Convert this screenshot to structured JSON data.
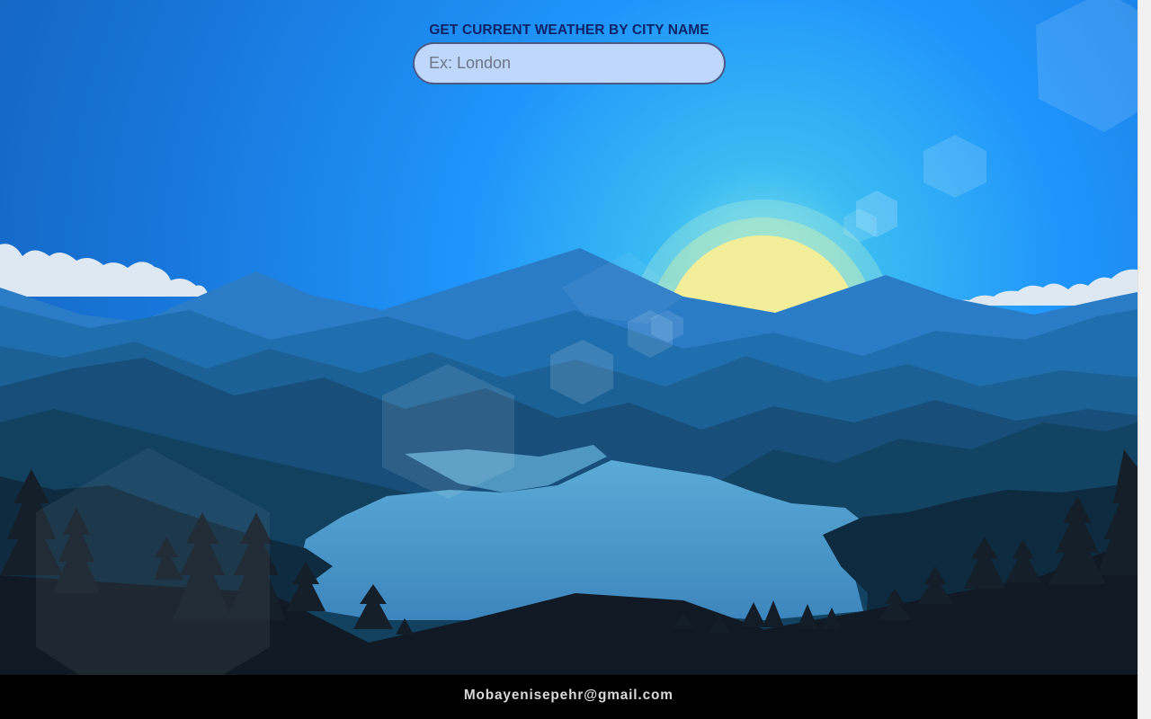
{
  "search": {
    "label": "GET CURRENT WEATHER BY CITY NAME",
    "placeholder": "Ex: London",
    "value": ""
  },
  "footer": {
    "email": "Mobayenisepehr@gmail.com"
  },
  "background": {
    "description_icon": "landscape-illustration",
    "colors": {
      "sky_top": "#1565c9",
      "sky_mid": "#1e90ff",
      "sun": "#f3ee9a",
      "mountains_far": "#2479c2",
      "lake": "#4c9ccb",
      "forest": "#0f1620"
    }
  }
}
